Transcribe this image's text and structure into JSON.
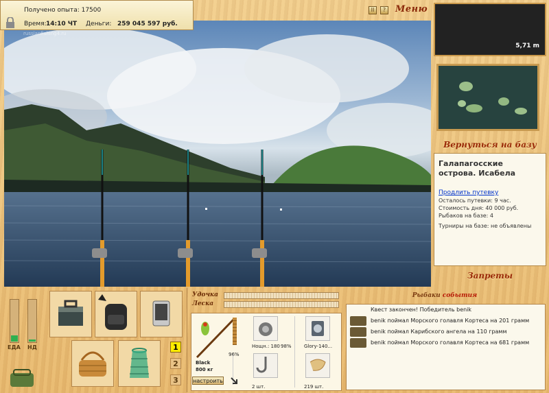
{
  "header": {
    "experience": "Получено опыта: 17500",
    "time_label": "Время:",
    "time_value": "14:10 ЧТ",
    "money_label": "Деньги:",
    "money_value": "259 045 597 руб.",
    "watermark": "russianfishing4.ru"
  },
  "top_buttons": {
    "pause": "II",
    "help": "?",
    "menu": "Меню"
  },
  "depth": "5,71 m",
  "return_button": "Вернуться на базу",
  "location": {
    "title": "Галапагосские острова. Исабела",
    "extend_link": "Продлить путевку",
    "remaining": "Осталось путевки: 9 час.",
    "cost": "Стоимость дня: 40 000 руб.",
    "fishers": "Рыбаков на базе: 4",
    "tournaments": "Турниры на базе: не объявлены"
  },
  "bans_button": "Запреты",
  "status": {
    "food_label": "ЕДА",
    "nd_label": "НД",
    "food_level": 0.15,
    "nd_level": 0.05
  },
  "rod_numbers": [
    "1",
    "2",
    "3"
  ],
  "active_rod": "1",
  "rod": {
    "rod_label": "Удочка",
    "line_label": "Леска",
    "name": "Black",
    "weight": "800 кг",
    "rod_condition": "96%",
    "reel_name": "Нощн.: 180",
    "reel_condition": "98%",
    "line_name": "Glory-140...",
    "hook_count": "2 шт.",
    "bait_count": "219 шт.",
    "configure": "настроить"
  },
  "events": {
    "header_a": "Рыбаки",
    "header_b": "события",
    "quest": "Квест закончен! Победитель benik",
    "items": [
      "benik поймал Морского голавля Кортеса на 201 грамм",
      "benik поймал Карибского ангела на 110 грамм",
      "benik поймал Морского голавля Кортеса на 681 грамм"
    ]
  },
  "colors": {
    "menu_text": "#8b2a0a",
    "active_rod": "#ffec00",
    "meter_fill": "#2fb050"
  }
}
